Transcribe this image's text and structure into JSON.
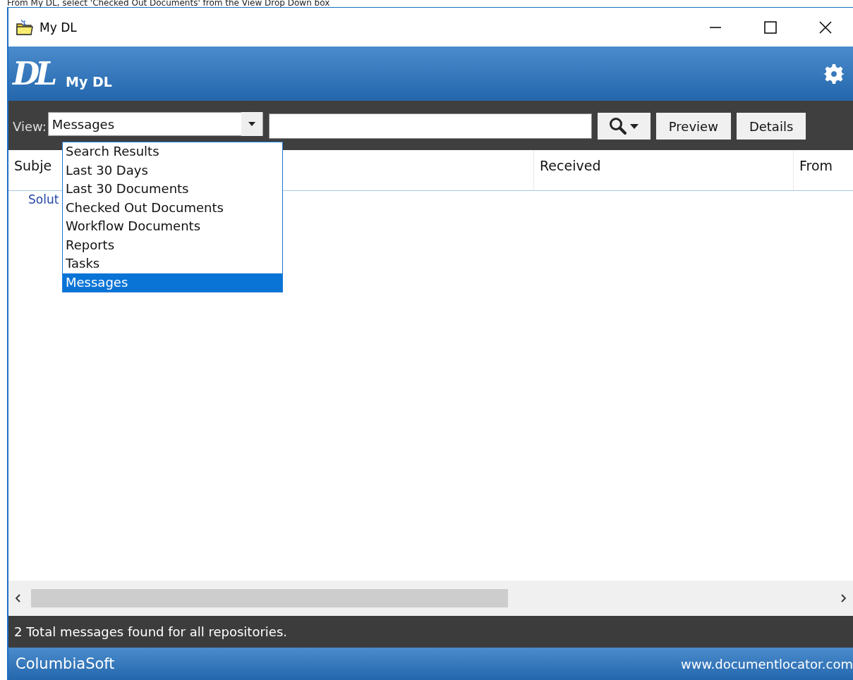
{
  "caption": "From My DL, select 'Checked Out Documents' from the View Drop Down box",
  "window": {
    "title": "My DL"
  },
  "header": {
    "logo": "DL",
    "title": "My DL"
  },
  "toolbar": {
    "view_label": "View:",
    "view_value": "Messages",
    "buttons": [
      "Preview",
      "Details"
    ]
  },
  "view_dropdown": {
    "options": [
      {
        "label": "Search Results",
        "selected": false
      },
      {
        "label": "Last 30 Days",
        "selected": false
      },
      {
        "label": "Last 30 Documents",
        "selected": false
      },
      {
        "label": "Checked Out Documents",
        "selected": false
      },
      {
        "label": "Workflow Documents",
        "selected": false
      },
      {
        "label": "Reports",
        "selected": false
      },
      {
        "label": "Tasks",
        "selected": false
      },
      {
        "label": "Messages",
        "selected": true
      }
    ]
  },
  "table": {
    "columns": [
      "Subje",
      "Received",
      "From"
    ],
    "rows": [
      {
        "subject": "Solut"
      }
    ]
  },
  "status_bar": "2 Total messages found for all repositories.",
  "footer": {
    "brand": "ColumbiaSoft",
    "url": "www.documentlocator.com"
  }
}
